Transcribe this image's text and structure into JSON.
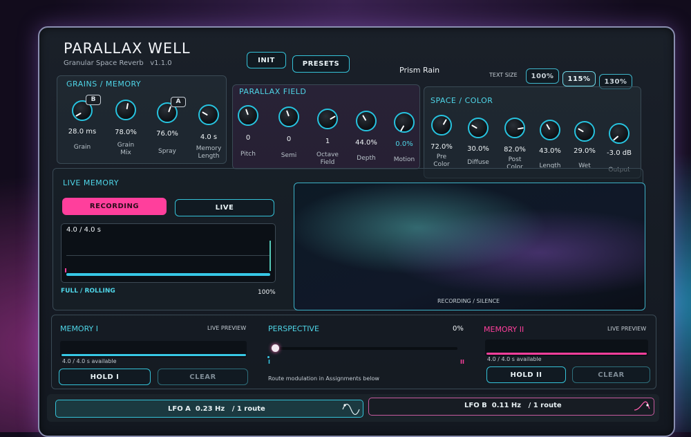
{
  "header": {
    "title": "PARALLAX WELL",
    "subtitle": "Granular Space Reverb",
    "version": "v1.1.0",
    "init_label": "INIT",
    "presets_label": "PRESETS",
    "preset_name": "Prism Rain",
    "text_size_label": "TEXT SIZE",
    "text_sizes": [
      "100%",
      "115%",
      "130%"
    ],
    "text_size_selected": "115%"
  },
  "grains": {
    "title": "GRAINS / MEMORY",
    "knobs": [
      {
        "label": "Grain",
        "value": "28.0 ms",
        "tag": "B"
      },
      {
        "label": "Grain\nMix",
        "value": "78.0%"
      },
      {
        "label": "Spray",
        "value": "76.0%",
        "tag": "A"
      },
      {
        "label": "Memory\nLength",
        "value": "4.0 s"
      }
    ]
  },
  "parallax": {
    "title": "PARALLAX FIELD",
    "knobs": [
      {
        "label": "Pitch",
        "value": "0"
      },
      {
        "label": "Semi",
        "value": "0"
      },
      {
        "label": "Octave\nField",
        "value": "1"
      },
      {
        "label": "Depth",
        "value": "44.0%"
      },
      {
        "label": "Motion",
        "value": "0.0%"
      }
    ]
  },
  "space": {
    "title": "SPACE / COLOR",
    "knobs": [
      {
        "label": "Pre\nColor",
        "value": "72.0%"
      },
      {
        "label": "Diffuse",
        "value": "30.0%"
      },
      {
        "label": "Post\nColor",
        "value": "82.0%"
      },
      {
        "label": "Length",
        "value": "43.0%"
      },
      {
        "label": "Wet",
        "value": "29.0%"
      },
      {
        "label": "Output",
        "value": "-3.0 dB"
      }
    ]
  },
  "live_memory": {
    "title": "LIVE MEMORY",
    "recording_label": "RECORDING",
    "live_label": "LIVE",
    "buffer_readout": "4.0 / 4.0 s",
    "mode": "FULL / ROLLING",
    "fill_percent": "100%",
    "display_caption": "RECORDING / SILENCE"
  },
  "memory1": {
    "title": "MEMORY I",
    "preview": "LIVE PREVIEW",
    "available": "4.0 / 4.0 s available",
    "hold_label": "HOLD I",
    "clear_label": "CLEAR"
  },
  "perspective": {
    "title": "PERSPECTIVE",
    "value": "0%",
    "left_mark": "I",
    "right_mark": "II",
    "note": "Route modulation in Assignments below"
  },
  "memory2": {
    "title": "MEMORY II",
    "preview": "LIVE PREVIEW",
    "available": "4.0 / 4.0 s available",
    "hold_label": "HOLD II",
    "clear_label": "CLEAR"
  },
  "lfo_a": {
    "name": "LFO A",
    "rate": "0.23 Hz",
    "routes": "/ 1 route"
  },
  "lfo_b": {
    "name": "LFO B",
    "rate": "0.11 Hz",
    "routes": "/ 1 route"
  },
  "colors": {
    "accent": "#35c3d9",
    "pink": "#ff3f9c"
  }
}
